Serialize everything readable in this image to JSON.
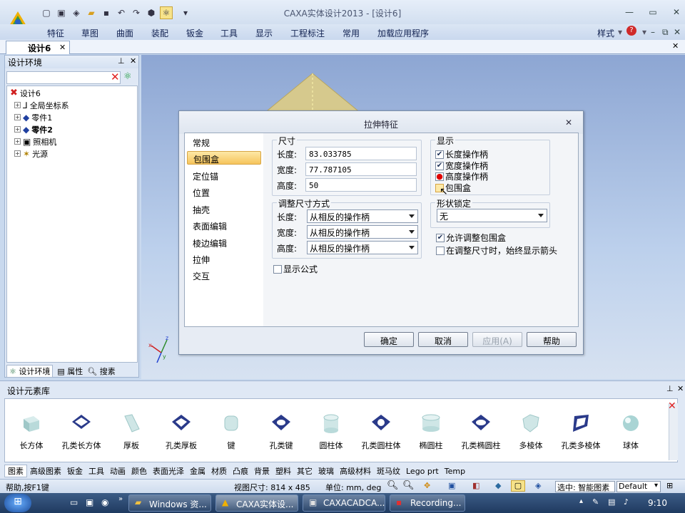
{
  "window": {
    "title": "CAXA实体设计2013 - [设计6]"
  },
  "menu": [
    "特征",
    "草图",
    "曲面",
    "装配",
    "钣金",
    "工具",
    "显示",
    "工程标注",
    "常用",
    "加载应用程序"
  ],
  "menu_right": {
    "style_label": "样式"
  },
  "doc_tab": {
    "label": "设计6"
  },
  "left_panel": {
    "title": "设计环境",
    "tree": [
      {
        "label": "设计6",
        "bold": false
      },
      {
        "label": "全局坐标系",
        "bold": false
      },
      {
        "label": "零件1",
        "bold": false
      },
      {
        "label": "零件2",
        "bold": true
      },
      {
        "label": "照相机",
        "bold": false
      },
      {
        "label": "光源",
        "bold": false
      }
    ],
    "tabs": [
      "设计环境",
      "属性",
      "搜素"
    ]
  },
  "dialog": {
    "title": "拉伸特征",
    "categories": [
      "常规",
      "包围盒",
      "定位锚",
      "位置",
      "抽壳",
      "表面编辑",
      "棱边编辑",
      "拉伸",
      "交互"
    ],
    "selected_category": "包围盒",
    "size_group": {
      "title": "尺寸",
      "length_label": "长度:",
      "length_value": "83.033785",
      "width_label": "宽度:",
      "width_value": "77.787105",
      "height_label": "高度:",
      "height_value": "50"
    },
    "adjust_group": {
      "title": "调整尺寸方式",
      "length_label": "长度:",
      "length_value": "从相反的操作柄",
      "width_label": "宽度:",
      "width_value": "从相反的操作柄",
      "height_label": "高度:",
      "height_value": "从相反的操作柄"
    },
    "show_formula": {
      "label": "显示公式",
      "checked": false
    },
    "display_group": {
      "title": "显示",
      "length_handle": {
        "label": "长度操作柄",
        "checked": true
      },
      "width_handle": {
        "label": "宽度操作柄",
        "checked": true
      },
      "height_handle": {
        "label": "高度操作柄",
        "checked": true
      },
      "bbox": {
        "label": "包围盒",
        "checked": false
      }
    },
    "shape_lock": {
      "title": "形状锁定",
      "value": "无"
    },
    "allow_adjust": {
      "label": "允许调整包围盒",
      "checked": true
    },
    "always_arrow": {
      "label": "在调整尺寸时，始终显示箭头",
      "checked": false
    },
    "buttons": {
      "ok": "确定",
      "cancel": "取消",
      "apply": "应用(A)",
      "help": "帮助"
    }
  },
  "library": {
    "title": "设计元素库",
    "items": [
      "长方体",
      "孔类长方体",
      "厚板",
      "孔类厚板",
      "键",
      "孔类键",
      "圆柱体",
      "孔类圆柱体",
      "椭圆柱",
      "孔类椭圆柱",
      "多棱体",
      "孔类多棱体",
      "球体"
    ],
    "tabs": [
      "图素",
      "高级图素",
      "钣金",
      "工具",
      "动画",
      "颜色",
      "表面光泽",
      "金属",
      "材质",
      "凸痕",
      "背景",
      "塑料",
      "其它",
      "玻璃",
      "高级材料",
      "斑马纹",
      "Lego prt",
      "Temp"
    ]
  },
  "status": {
    "help": "帮助,按F1键",
    "view_size": "视图尺寸: 814 x 485",
    "units": "单位: mm, deg",
    "select": "选中: 智能图素",
    "style": "Default"
  },
  "taskbar": {
    "tasks": [
      "Windows 资...",
      "CAXA实体设...",
      "CAXACADCA...",
      "Recording..."
    ],
    "clock": "9:10"
  },
  "colors": {
    "accent": "#f6c45c",
    "titlebar": "#d2dff0"
  }
}
